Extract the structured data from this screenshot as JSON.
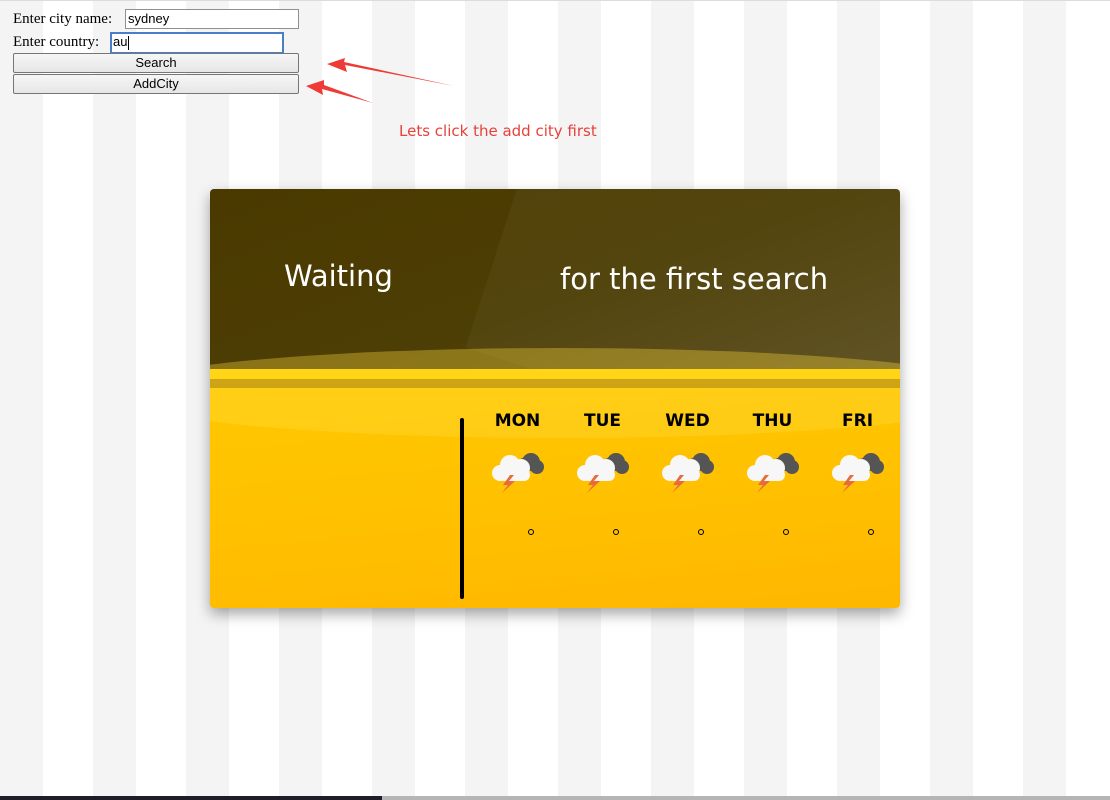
{
  "form": {
    "city_label": "Enter city name:",
    "city_value": "sydney",
    "country_label": "Enter country:",
    "country_value": "au",
    "search_label": "Search",
    "addcity_label": "AddCity"
  },
  "annotation": {
    "text": "Lets click the add city first",
    "color": "#e8413a"
  },
  "card": {
    "left_title": "Waiting",
    "right_title": "for the first search",
    "days": [
      {
        "name": "MON",
        "icon": "thunderstorm-icon"
      },
      {
        "name": "TUE",
        "icon": "thunderstorm-icon"
      },
      {
        "name": "WED",
        "icon": "thunderstorm-icon"
      },
      {
        "name": "THU",
        "icon": "thunderstorm-icon"
      },
      {
        "name": "FRI",
        "icon": "thunderstorm-icon"
      }
    ],
    "colors": {
      "top": "#4a3a00",
      "bottom": "#ffc000",
      "band_light": "#ffd100",
      "band_dark": "#b38600"
    }
  }
}
